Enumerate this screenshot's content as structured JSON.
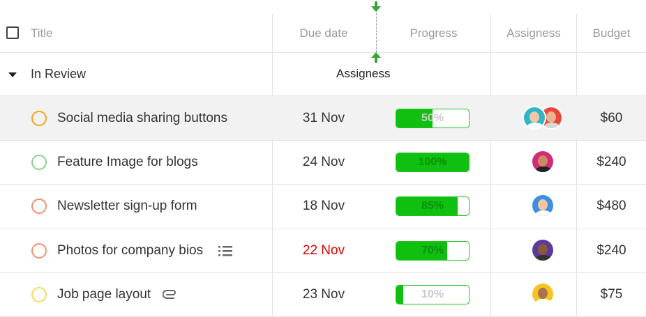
{
  "header": {
    "title": "Title",
    "due_date": "Due date",
    "progress": "Progress",
    "assigness": "Assigness",
    "budget": "Budget"
  },
  "group": {
    "label": "In Review",
    "drag_label": "Assigness"
  },
  "colors": {
    "progress_fill": "#10c010",
    "overdue": "#e00000"
  },
  "rows": [
    {
      "title": "Social media sharing buttons",
      "title_icon": "",
      "status_color": "#f4a418",
      "due": "31 Nov",
      "overdue": false,
      "progress": 50,
      "progress_label": "50%",
      "avatars": [
        "avatar-woman-teal",
        "avatar-man-red"
      ],
      "budget": "$60",
      "selected": true
    },
    {
      "title": "Feature Image for blogs",
      "title_icon": "",
      "status_color": "#8ad18a",
      "due": "24 Nov",
      "overdue": false,
      "progress": 100,
      "progress_label": "100%",
      "avatars": [
        "avatar-woman-magenta"
      ],
      "budget": "$240",
      "selected": false
    },
    {
      "title": "Newsletter sign-up form",
      "title_icon": "",
      "status_color": "#f29072",
      "due": "18 Nov",
      "overdue": false,
      "progress": 85,
      "progress_label": "85%",
      "avatars": [
        "avatar-man-blue"
      ],
      "budget": "$480",
      "selected": false
    },
    {
      "title": "Photos for company bios",
      "title_icon": "list-icon",
      "status_color": "#f29072",
      "due": "22 Nov",
      "overdue": true,
      "progress": 70,
      "progress_label": "70%",
      "avatars": [
        "avatar-woman-purple"
      ],
      "budget": "$240",
      "selected": false
    },
    {
      "title": "Job page layout",
      "title_icon": "paperclip-icon",
      "status_color": "#f6d860",
      "due": "23 Nov",
      "overdue": false,
      "progress": 10,
      "progress_label": "10%",
      "avatars": [
        "avatar-man-yellow"
      ],
      "budget": "$75",
      "selected": false
    }
  ]
}
